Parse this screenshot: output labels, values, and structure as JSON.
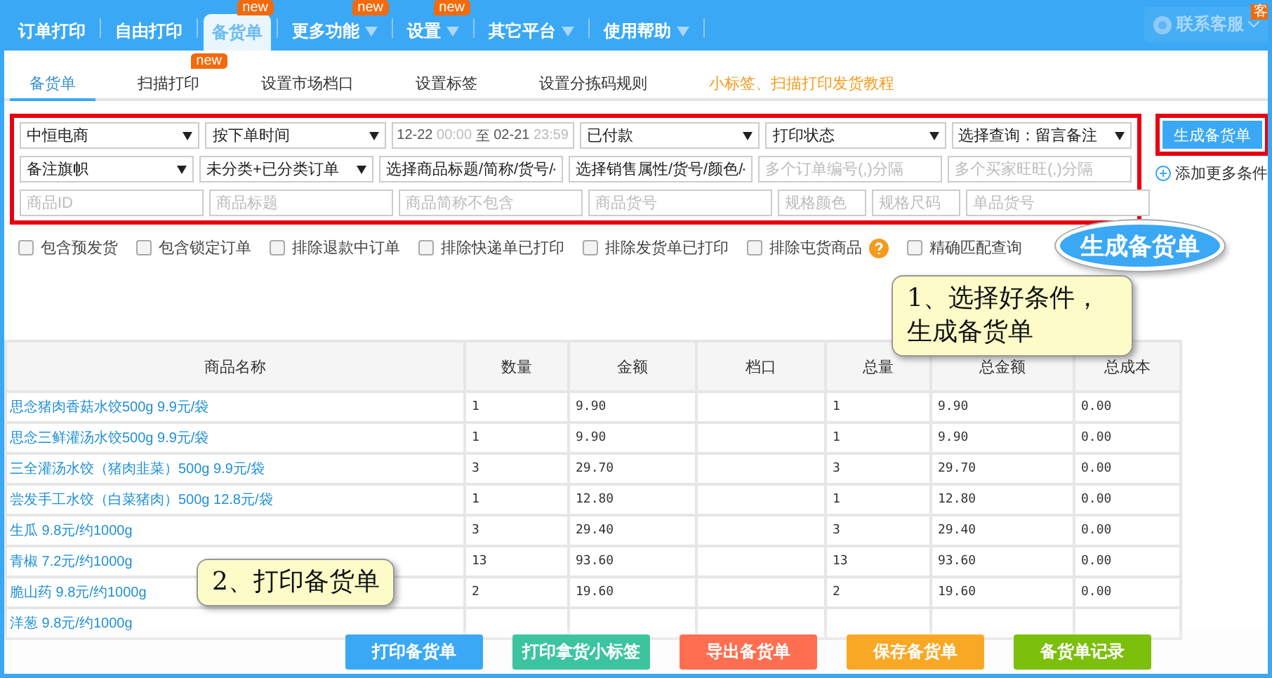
{
  "nav": {
    "items": [
      {
        "label": "订单打印",
        "selected": false,
        "dropdown": false
      },
      {
        "label": "自由打印",
        "selected": false,
        "dropdown": false
      },
      {
        "label": "备货单",
        "selected": true,
        "dropdown": false,
        "badge": "new"
      },
      {
        "label": "更多功能",
        "selected": false,
        "dropdown": true,
        "badge": "new"
      },
      {
        "label": "设置",
        "selected": false,
        "dropdown": true,
        "badge": "new"
      },
      {
        "label": "其它平台",
        "selected": false,
        "dropdown": true
      },
      {
        "label": "使用帮助",
        "selected": false,
        "dropdown": true
      }
    ],
    "service": {
      "label": "联系客服",
      "badge": "客"
    }
  },
  "subtabs": [
    {
      "label": "备货单",
      "selected": true,
      "kind": "tab"
    },
    {
      "label": "扫描打印",
      "selected": false,
      "kind": "tab",
      "badge": "new"
    },
    {
      "label": "设置市场档口",
      "selected": false,
      "kind": "tab"
    },
    {
      "label": "设置标签",
      "selected": false,
      "kind": "tab"
    },
    {
      "label": "设置分拣码规则",
      "selected": false,
      "kind": "tab"
    },
    {
      "label": "小标签、扫描打印发货教程",
      "selected": false,
      "kind": "link"
    }
  ],
  "filters": {
    "row_1": [
      {
        "kind": "select",
        "value": "中恒电商"
      },
      {
        "kind": "select",
        "value": "按下单时间"
      },
      {
        "kind": "daterange",
        "start_date": "12-22",
        "start_time": "00:00",
        "separator": "至",
        "end_date": "02-21",
        "end_time": "23:59"
      },
      {
        "kind": "select",
        "value": "已付款"
      },
      {
        "kind": "select",
        "value": "打印状态"
      },
      {
        "kind": "select",
        "value": "选择查询：留言备注"
      }
    ],
    "row_2": [
      {
        "kind": "select",
        "value": "备注旗帜"
      },
      {
        "kind": "select",
        "value": "未分类+已分类订单"
      },
      {
        "kind": "select",
        "value": "选择商品标题/简称/货号/"
      },
      {
        "kind": "select",
        "value": "选择销售属性/货号/颜色/"
      },
      {
        "kind": "input",
        "placeholder": "多个订单编号(,)分隔"
      },
      {
        "kind": "input",
        "placeholder": "多个买家旺旺(,)分隔"
      }
    ],
    "row_3": [
      {
        "kind": "input",
        "placeholder": "商品ID"
      },
      {
        "kind": "input",
        "placeholder": "商品标题"
      },
      {
        "kind": "input",
        "placeholder": "商品简称不包含"
      },
      {
        "kind": "input",
        "placeholder": "商品货号"
      },
      {
        "kind": "narrow",
        "placeholder": "规格颜色"
      },
      {
        "kind": "narrow",
        "placeholder": "规格尺码"
      },
      {
        "kind": "input",
        "placeholder": "单品货号"
      }
    ],
    "generate_button": "生成备货单",
    "add_more": "添加更多条件"
  },
  "options": [
    {
      "label": "包含预发货",
      "checked": false
    },
    {
      "label": "包含锁定订单",
      "checked": false
    },
    {
      "label": "排除退款中订单",
      "checked": false
    },
    {
      "label": "排除快递单已打印",
      "checked": false
    },
    {
      "label": "排除发货单已打印",
      "checked": false
    },
    {
      "label": "排除屯货商品",
      "checked": false,
      "help": true
    },
    {
      "label": "精确匹配查询",
      "checked": false
    }
  ],
  "table": {
    "columns": [
      "商品名称",
      "数量",
      "金额",
      "档口",
      "总量",
      "总金额",
      "总成本"
    ],
    "rows": [
      {
        "cells": [
          "思念猪肉香菇水饺500g  9.9元/袋",
          "1",
          "9.90",
          "",
          "1",
          "9.90",
          "0.00"
        ]
      },
      {
        "cells": [
          "思念三鲜灌汤水饺500g  9.9元/袋",
          "1",
          "9.90",
          "",
          "1",
          "9.90",
          "0.00"
        ]
      },
      {
        "cells": [
          "三全灌汤水饺（猪肉韭菜）500g  9.9元/袋",
          "3",
          "29.70",
          "",
          "3",
          "29.70",
          "0.00"
        ]
      },
      {
        "cells": [
          "尝发手工水饺（白菜猪肉）500g  12.8元/袋",
          "1",
          "12.80",
          "",
          "1",
          "12.80",
          "0.00"
        ]
      },
      {
        "cells": [
          "生瓜  9.8元/约1000g",
          "3",
          "29.40",
          "",
          "3",
          "29.40",
          "0.00"
        ]
      },
      {
        "cells": [
          "青椒  7.2元/约1000g",
          "13",
          "93.60",
          "",
          "13",
          "93.60",
          "0.00"
        ]
      },
      {
        "cells": [
          "脆山药  9.8元/约1000g",
          "2",
          "19.60",
          "",
          "2",
          "19.60",
          "0.00"
        ]
      },
      {
        "cells": [
          "洋葱  9.8元/约1000g",
          "",
          "",
          "",
          "",
          "",
          ""
        ]
      }
    ]
  },
  "actions": [
    {
      "label": "打印备货单",
      "color": "#3aa8f5"
    },
    {
      "label": "打印拿货小标签",
      "color": "#3cc4a0"
    },
    {
      "label": "导出备货单",
      "color": "#ff6e50"
    },
    {
      "label": "保存备货单",
      "color": "#f9a825"
    },
    {
      "label": "备货单记录",
      "color": "#7cbf0c"
    }
  ],
  "callouts": [
    {
      "kind": "bubble",
      "text": "生成备货单"
    },
    {
      "kind": "note_up",
      "text": "1、选择好条件，生成备货单"
    },
    {
      "kind": "note_down",
      "text": "2、打印备货单"
    }
  ]
}
